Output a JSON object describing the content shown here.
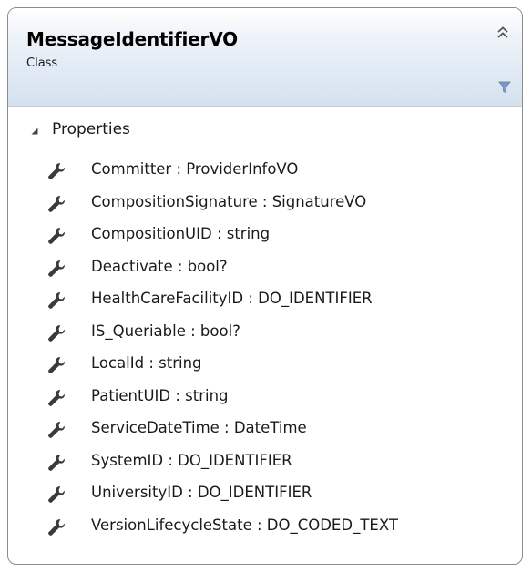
{
  "class": {
    "name": "MessageIdentifierVO",
    "stereotype": "Class"
  },
  "icons": {
    "collapse": "double-chevron-up-icon",
    "filter": "filter-icon",
    "expander": "triangle-expander-icon",
    "property": "wrench-icon"
  },
  "section": {
    "label": "Properties"
  },
  "properties": [
    "Committer : ProviderInfoVO",
    "CompositionSignature : SignatureVO",
    "CompositionUID : string",
    "Deactivate : bool?",
    "HealthCareFacilityID : DO_IDENTIFIER",
    "IS_Queriable : bool?",
    "LocalId : string",
    "PatientUID : string",
    "ServiceDateTime : DateTime",
    "SystemID : DO_IDENTIFIER",
    "UniversityID : DO_IDENTIFIER",
    "VersionLifecycleState : DO_CODED_TEXT"
  ],
  "colors": {
    "header_gradient_end": "#d4e1f0",
    "border": "#8c8c8c",
    "wrench": "#3a3a3a",
    "filter": "#7a9bc4"
  }
}
